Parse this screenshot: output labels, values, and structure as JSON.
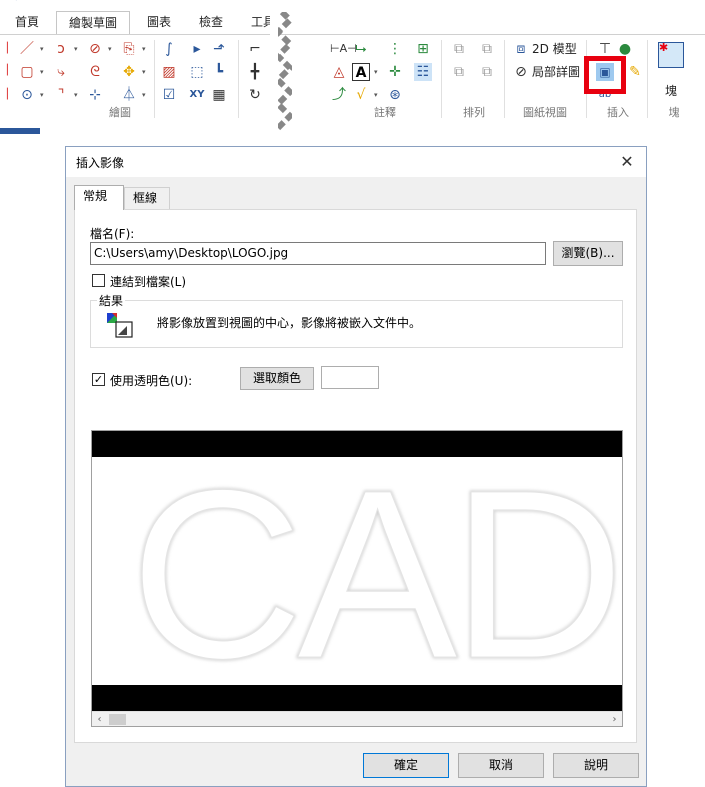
{
  "ribbon": {
    "tabs": [
      {
        "label": "首頁"
      },
      {
        "label": "繪製草圖"
      },
      {
        "label": "圖表"
      },
      {
        "label": "檢查"
      },
      {
        "label": "工具"
      }
    ],
    "groups": [
      {
        "label": "繪圖"
      },
      {
        "label": "註釋"
      },
      {
        "label": "排列"
      },
      {
        "label": "圖紙視圖"
      },
      {
        "label": "插入"
      },
      {
        "label": "塊"
      }
    ],
    "tools": {
      "model_2d": "2D 模型",
      "detail_view": "局部詳圖",
      "xy_label": "XY",
      "block_label": "塊"
    },
    "highlight_color": "#e8000f"
  },
  "dialog": {
    "title": "插入影像",
    "tabs": [
      {
        "label": "常規"
      },
      {
        "label": "框線"
      }
    ],
    "filename_label": "檔名(F):",
    "filename_value": "C:\\Users\\amy\\Desktop\\LOGO.jpg",
    "browse_label": "瀏覽(B)...",
    "link_label": "連結到檔案(L)",
    "link_checked": false,
    "result_title": "結果",
    "result_text": "將影像放置到視圖的中心，影像將被嵌入文件中。",
    "transparent_label": "使用透明色(U):",
    "transparent_checked": true,
    "choose_color_label": "選取顏色",
    "preview_text": "CAD",
    "ok_label": "確定",
    "cancel_label": "取消",
    "help_label": "說明"
  }
}
